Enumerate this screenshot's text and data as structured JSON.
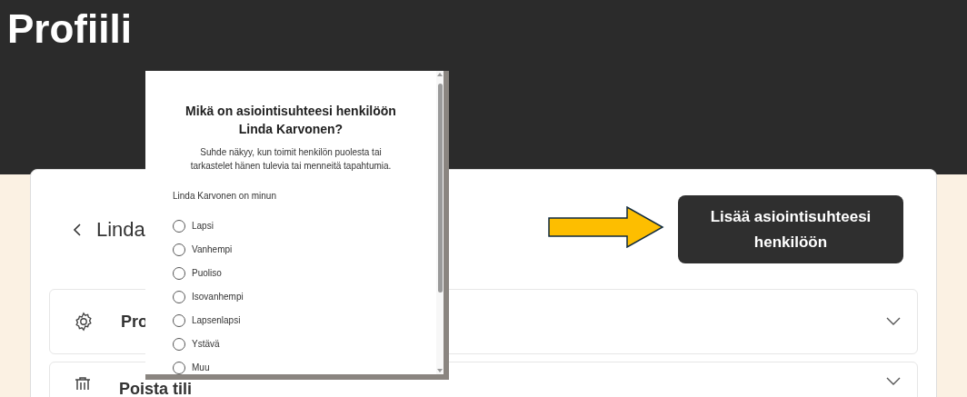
{
  "page": {
    "title": "Profiili"
  },
  "profile": {
    "name": "Linda",
    "action_button": "Lisää asiointisuhteesi henkilöön"
  },
  "accordion": [
    {
      "label": "Pro",
      "kind": "settings",
      "expanded": false
    },
    {
      "label": "Poista tili",
      "kind": "delete",
      "expanded": false
    }
  ],
  "dialog": {
    "title": "Mikä on asiointisuhteesi henkilöön Linda Karvonen?",
    "description": "Suhde näkyy, kun toimit henkilön puolesta tai tarkastelet hänen tulevia tai menneitä tapahtumia.",
    "group_label": "Linda Karvonen on minun",
    "options": [
      {
        "label": "Lapsi",
        "selected": false
      },
      {
        "label": "Vanhempi",
        "selected": false
      },
      {
        "label": "Puoliso",
        "selected": false
      },
      {
        "label": "Isovanhempi",
        "selected": false
      },
      {
        "label": "Lapsenlapsi",
        "selected": false
      },
      {
        "label": "Ystävä",
        "selected": false
      },
      {
        "label": "Muu",
        "selected": false
      }
    ]
  }
}
